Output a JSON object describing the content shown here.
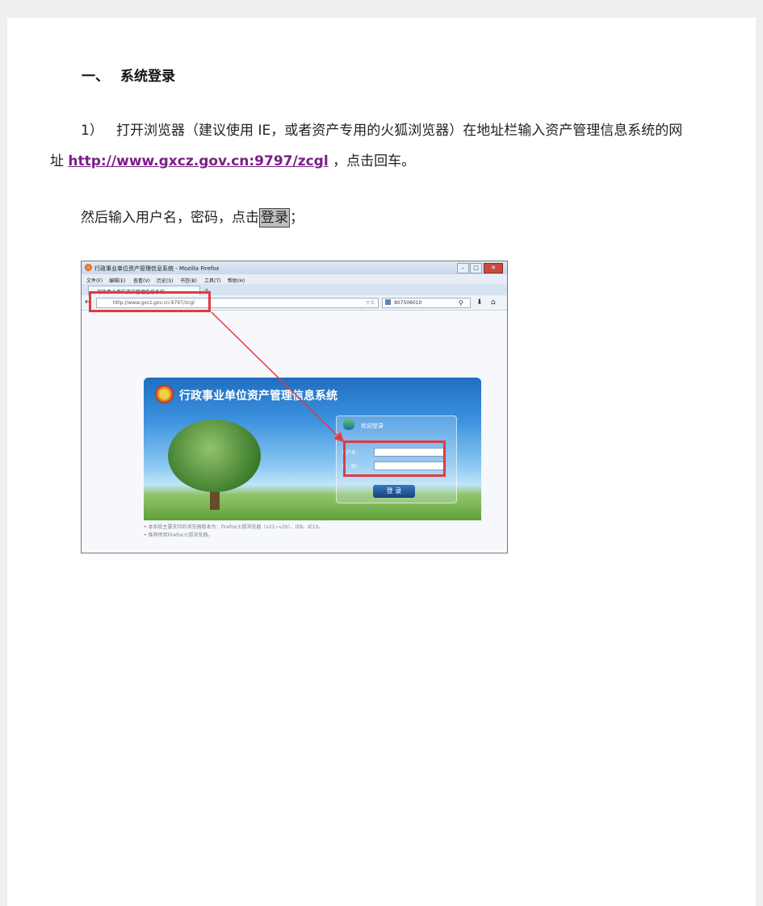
{
  "heading": {
    "number": "一、",
    "title": "系统登录"
  },
  "step1": {
    "prefix": "1）",
    "text_before_link": "打开浏览器（建议使用 IE，或者资产专用的火狐浏览器）在地址栏输入资产管理信息系统的网",
    "line2_prefix": "址",
    "link": "http://www.gxcz.gov.cn:9797/zcgl",
    "text_after_link": "，点击回车。"
  },
  "step2": {
    "text": "然后输入用户名，密码，点击",
    "button_word": "登录",
    "suffix": "；"
  },
  "screenshot": {
    "window_title": "行政事业单位资产管理信息系统 - Mozilla Firefox",
    "menu": [
      "文件(F)",
      "编辑(E)",
      "查看(V)",
      "历史(S)",
      "书签(B)",
      "工具(T)",
      "帮助(H)"
    ],
    "tab_title": "行政事业单位资产管理信息系统",
    "tab_plus": "+",
    "url": "http://www.gxcz.gov.cn:9797/zcgl",
    "reload_symbol": "▽ C",
    "search_value": "907506010",
    "window_controls": [
      "–",
      "□",
      "✕"
    ],
    "system_title": "行政事业单位资产管理信息系统",
    "welcome": "欢迎登录",
    "username_label": "用户名：",
    "password_label": "密　码：",
    "login_button": "登 录",
    "notes": [
      "本系统主要支持的浏览器版本为：Firefox火狐浏览器（v21~v26）、IE8、IE10。",
      "推荐使用Firefox火狐浏览器。"
    ],
    "accent_color": "#e13a3f"
  }
}
